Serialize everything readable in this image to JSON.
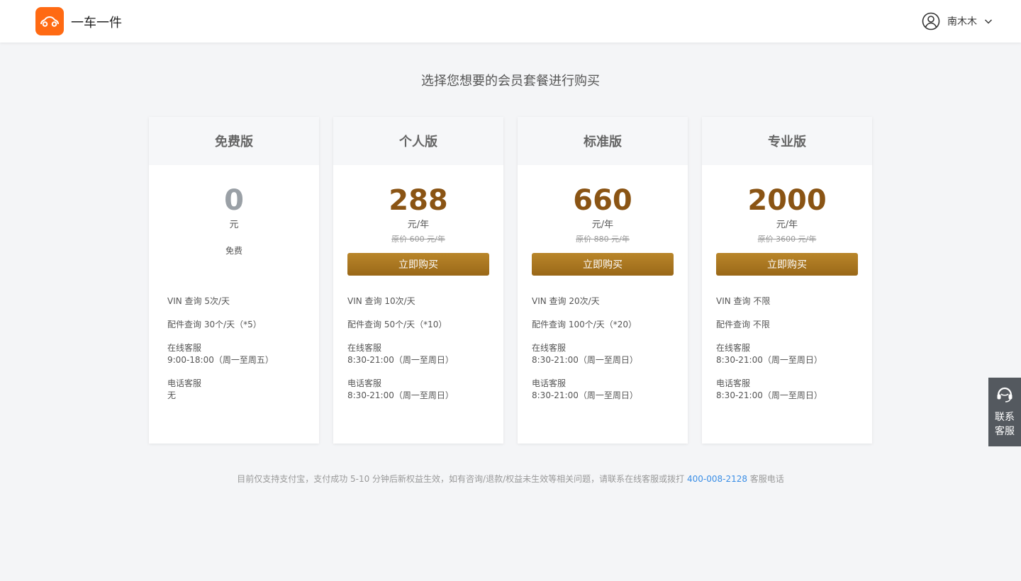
{
  "header": {
    "brand": "一车一件",
    "user_name": "南木木",
    "logo_icon": "car-icon",
    "accent": "#ff6a13"
  },
  "heading": "选择您想要的会员套餐进行购买",
  "plans": [
    {
      "name": "免费版",
      "price": "0",
      "unit": "元",
      "note": "免费",
      "features": [
        "VIN 查询 5次/天",
        "配件查询 30个/天（*5）",
        "在线客服",
        "9:00-18:00（周一至周五）",
        "电话客服",
        "无"
      ]
    },
    {
      "name": "个人版",
      "price": "288",
      "unit": "元/年",
      "original": "原价 600 元/年",
      "buy_label": "立即购买",
      "features": [
        "VIN 查询 10次/天",
        "配件查询 50个/天（*10）",
        "在线客服",
        "8:30-21:00（周一至周日）",
        "电话客服",
        "8:30-21:00（周一至周日）"
      ]
    },
    {
      "name": "标准版",
      "price": "660",
      "unit": "元/年",
      "original": "原价 880 元/年",
      "buy_label": "立即购买",
      "features": [
        "VIN 查询 20次/天",
        "配件查询 100个/天（*20）",
        "在线客服",
        "8:30-21:00（周一至周日）",
        "电话客服",
        "8:30-21:00（周一至周日）"
      ]
    },
    {
      "name": "专业版",
      "price": "2000",
      "unit": "元/年",
      "original": "原价 3600 元/年",
      "buy_label": "立即购买",
      "features": [
        "VIN 查询 不限",
        "配件查询 不限",
        "在线客服",
        "8:30-21:00（周一至周日）",
        "电话客服",
        "8:30-21:00（周一至周日）"
      ]
    }
  ],
  "footer": {
    "text_before": "目前仅支持支付宝，支付成功 5-10 分钟后新权益生效，如有咨询/退款/权益未生效等相关问题，请联系在线客服或拨打 ",
    "phone": "400-008-2128",
    "text_after": " 客服电话"
  },
  "contact": {
    "label": "联系客服",
    "icon": "headset-icon"
  },
  "colors": {
    "price": "#8a5414",
    "button": "#a97420",
    "link": "#3a8ee6"
  }
}
